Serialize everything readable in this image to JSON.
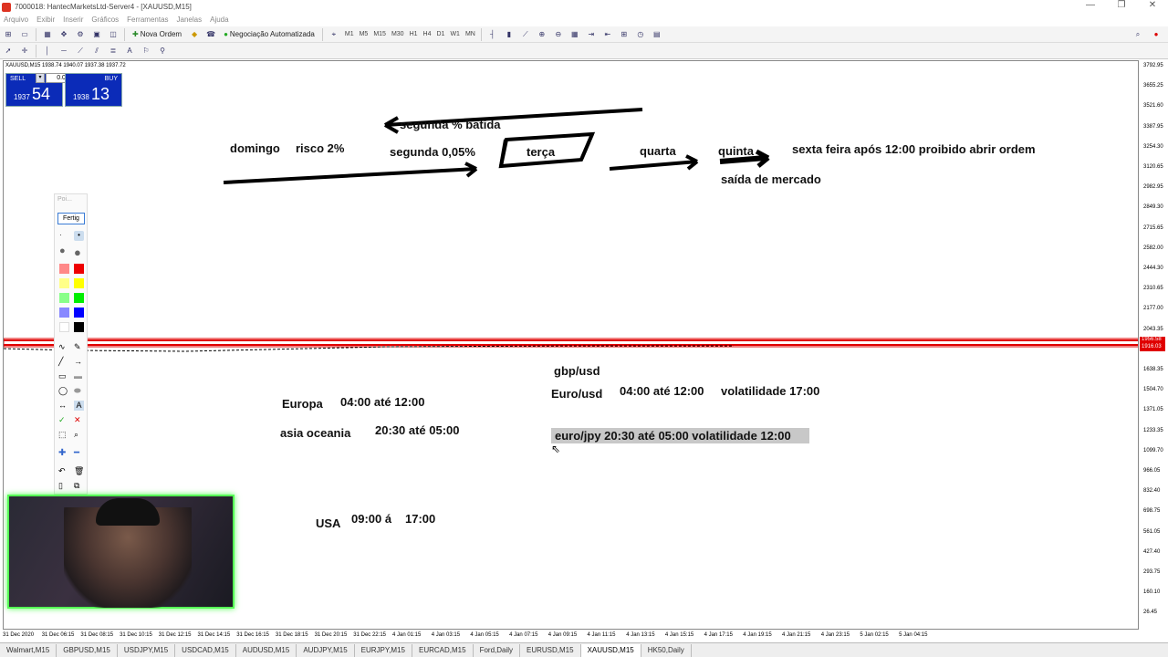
{
  "window": {
    "title": "7000018: HantecMarketsLtd-Server4 - [XAUUSD,M15]"
  },
  "menu": [
    "Arquivo",
    "Exibir",
    "Inserir",
    "Gráficos",
    "Ferramentas",
    "Janelas",
    "Ajuda"
  ],
  "toolbar": {
    "new_order": "Nova Ordem",
    "algo": "Negociação Automatizada",
    "timeframes": [
      "M1",
      "M5",
      "M15",
      "M30",
      "H1",
      "H4",
      "D1",
      "W1",
      "MN"
    ]
  },
  "chart": {
    "symbol_header": "XAUUSD,M15  1938.74 1940.07 1937.38 1937.72",
    "sell_label": "SELL",
    "buy_label": "BUY",
    "lot": "0.01",
    "sell_small": "1937",
    "sell_big": "54",
    "buy_small": "1938",
    "buy_big": "13",
    "line_price_1": "1956.58",
    "line_price_2": "1916.03"
  },
  "notes": {
    "domingo": "domingo",
    "risco": "risco 2%",
    "segunda_batida": "segunda % batida",
    "segunda": "segunda 0,05%",
    "terca": "terça",
    "quarta": "quarta",
    "quinta": "quinta",
    "sexta": "sexta feira após 12:00 proibido abrir ordem",
    "saida": "saída de mercado",
    "gbp": "gbp/usd",
    "euro": "Euro/usd",
    "euro_time": "04:00 até 12:00",
    "euro_vol": "volatilidade 17:00",
    "europa": "Europa",
    "europa_time": "04:00 até 12:00",
    "asia": "asia oceania",
    "asia_time": "20:30 até 05:00",
    "eurojpy": "euro/jpy 20:30 até 05:00 volatilidade 12:00",
    "usa": "USA",
    "usa_time": "09:00 á",
    "usa_end": "17:00"
  },
  "yaxis": [
    "3792.95",
    "3655.25",
    "3521.60",
    "3387.95",
    "3254.30",
    "3120.65",
    "2982.95",
    "2849.30",
    "2715.65",
    "2582.00",
    "2444.30",
    "2310.65",
    "2177.00",
    "2043.35",
    "1772.00",
    "1638.35",
    "1504.70",
    "1371.05",
    "1233.35",
    "1099.70",
    "966.05",
    "832.40",
    "698.75",
    "561.05",
    "427.40",
    "293.75",
    "160.10",
    "26.45"
  ],
  "xaxis": [
    "31 Dec 2020",
    "31 Dec 06:15",
    "31 Dec 08:15",
    "31 Dec 10:15",
    "31 Dec 12:15",
    "31 Dec 14:15",
    "31 Dec 16:15",
    "31 Dec 18:15",
    "31 Dec 20:15",
    "31 Dec 22:15",
    "4 Jan 01:15",
    "4 Jan 03:15",
    "4 Jan 05:15",
    "4 Jan 07:15",
    "4 Jan 09:15",
    "4 Jan 11:15",
    "4 Jan 13:15",
    "4 Jan 15:15",
    "4 Jan 17:15",
    "4 Jan 19:15",
    "4 Jan 21:15",
    "4 Jan 23:15",
    "5 Jan 02:15",
    "5 Jan 04:15"
  ],
  "tabs": [
    "Walmart,M15",
    "GBPUSD,M15",
    "USDJPY,M15",
    "USDCAD,M15",
    "AUDUSD,M15",
    "AUDJPY,M15",
    "EURJPY,M15",
    "EURCAD,M15",
    "Ford,Daily",
    "EURUSD,M15",
    "XAUUSD,M15",
    "HK50,Daily"
  ],
  "active_tab": "XAUUSD,M15",
  "palette": {
    "header": "Poi...",
    "button": "Fertig"
  },
  "colors": {
    "sell_buy": "#0b2bb8",
    "price_line": "#e00000",
    "highlight": "#c8c8c8",
    "webcam_border": "#55ff55"
  }
}
